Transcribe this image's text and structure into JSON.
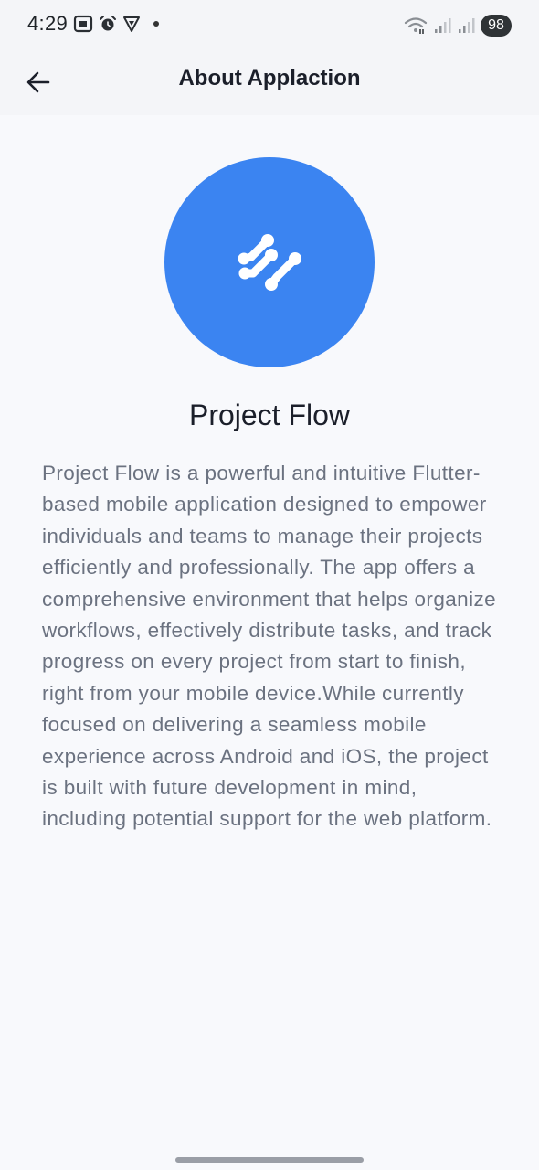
{
  "status_bar": {
    "time": "4:29",
    "battery": "98",
    "icons_left": [
      "screenshot-icon",
      "alarm-icon",
      "vpn-icon",
      "notification-dot"
    ],
    "icons_right": [
      "wifi-icon",
      "signal-icon",
      "signal-icon-2"
    ]
  },
  "app_bar": {
    "back_icon": "arrow-left-icon",
    "title": "About Applaction"
  },
  "logo": {
    "icon": "project-flow-logo-icon",
    "background_color": "#3b84f1"
  },
  "app_name": "Project Flow",
  "description": "Project Flow is a powerful and intuitive Flutter-based mobile application designed to empower individuals and teams to manage their projects efficiently and professionally. The app offers a comprehensive environment that helps organize workflows, effectively distribute tasks, and track progress on every project from start to finish, right from your mobile device.While currently focused on delivering a seamless mobile experience across Android and iOS, the project is built with future development in mind, including potential support for the web platform."
}
